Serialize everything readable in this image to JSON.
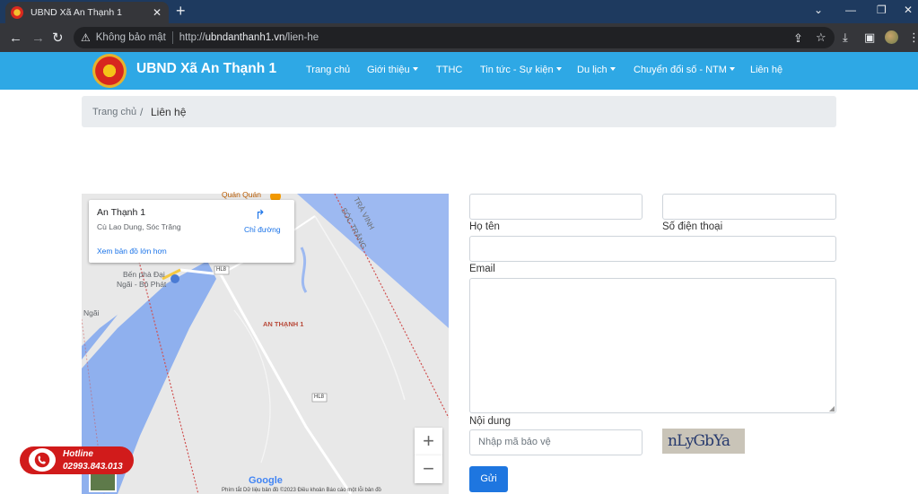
{
  "browser": {
    "tab_title": "UBND Xã An Thạnh 1",
    "close_tab": "✕",
    "new_tab": "+",
    "security_label": "Không bảo mật",
    "url_scheme": "http://",
    "url_host": "ubndanthanh1.vn",
    "url_path": "/lien-he"
  },
  "site": {
    "name": "UBND Xã An Thạnh 1",
    "nav": [
      "Trang chủ",
      "Giới thiệu",
      "TTHC",
      "Tin tức - Sự kiện",
      "Du lịch",
      "Chuyển đổi số - NTM",
      "Liên hệ"
    ]
  },
  "breadcrumb": {
    "home": "Trang chủ",
    "separator": "/",
    "current": "Liên hệ"
  },
  "map": {
    "place_title": "An Thạnh 1",
    "place_address": "Cù Lao Dung, Sóc Trăng",
    "larger_map": "Xem bản đồ lớn hơn",
    "directions": "Chỉ đường",
    "labels": {
      "poi": "Quán Quán",
      "province": "TRÀ VINH",
      "province2": "SÓC TRĂNG",
      "ferry1": "Bến phà Đại",
      "ferry2": "Ngãi - Bô Phát",
      "town": "Ngãi",
      "commune": "AN THẠNH 1",
      "road": "HL8"
    },
    "zoom_in": "+",
    "zoom_out": "−",
    "google": "Google",
    "attribution": "Phím tắt   Dữ liệu bản đồ ©2023   Điều khoản   Báo cáo một lỗi bản đồ"
  },
  "form": {
    "name_label": "Họ tên",
    "phone_label": "Số điện thoại",
    "email_label": "Email",
    "content_label": "Nội dung",
    "captcha_placeholder": "Nhập mã bảo vệ",
    "captcha_text": "nLyGbYa",
    "submit": "Gửi"
  },
  "hotline": {
    "title": "Hotline",
    "number": "02993.843.013"
  },
  "colors": {
    "site_blue": "#2ea8e5",
    "hotline_red": "#d11b1b",
    "button_blue": "#1e76e0"
  }
}
